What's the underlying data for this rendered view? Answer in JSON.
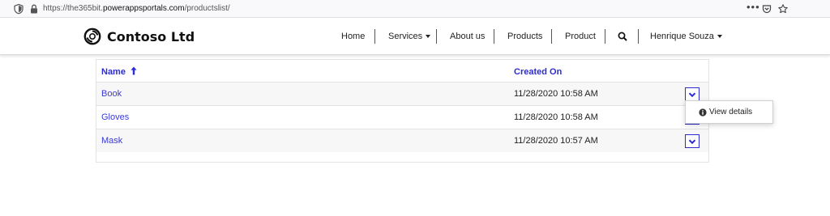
{
  "browser": {
    "url_prefix": "https://the365bit.",
    "url_host": "powerappsportals.com",
    "url_path": "/productslist/",
    "menu_dots": "•••"
  },
  "site": {
    "brand_name": "Contoso Ltd",
    "nav": {
      "home": "Home",
      "services": "Services",
      "about": "About us",
      "products": "Products",
      "product": "Product",
      "user": "Henrique Souza"
    }
  },
  "table": {
    "columns": {
      "name": "Name",
      "created_on": "Created On"
    },
    "sort_icon": "arrow-up-icon",
    "rows": [
      {
        "name": "Book",
        "created_on": "11/28/2020 10:58 AM"
      },
      {
        "name": "Gloves",
        "created_on": "11/28/2020 10:58 AM"
      },
      {
        "name": "Mask",
        "created_on": "11/28/2020 10:57 AM"
      }
    ]
  },
  "action_menu": {
    "view_details": "View details",
    "icon": "info-circle-icon"
  },
  "colors": {
    "link": "#2c2cd1",
    "row_stripe": "#f7f7f7",
    "header_text": "#111111"
  }
}
